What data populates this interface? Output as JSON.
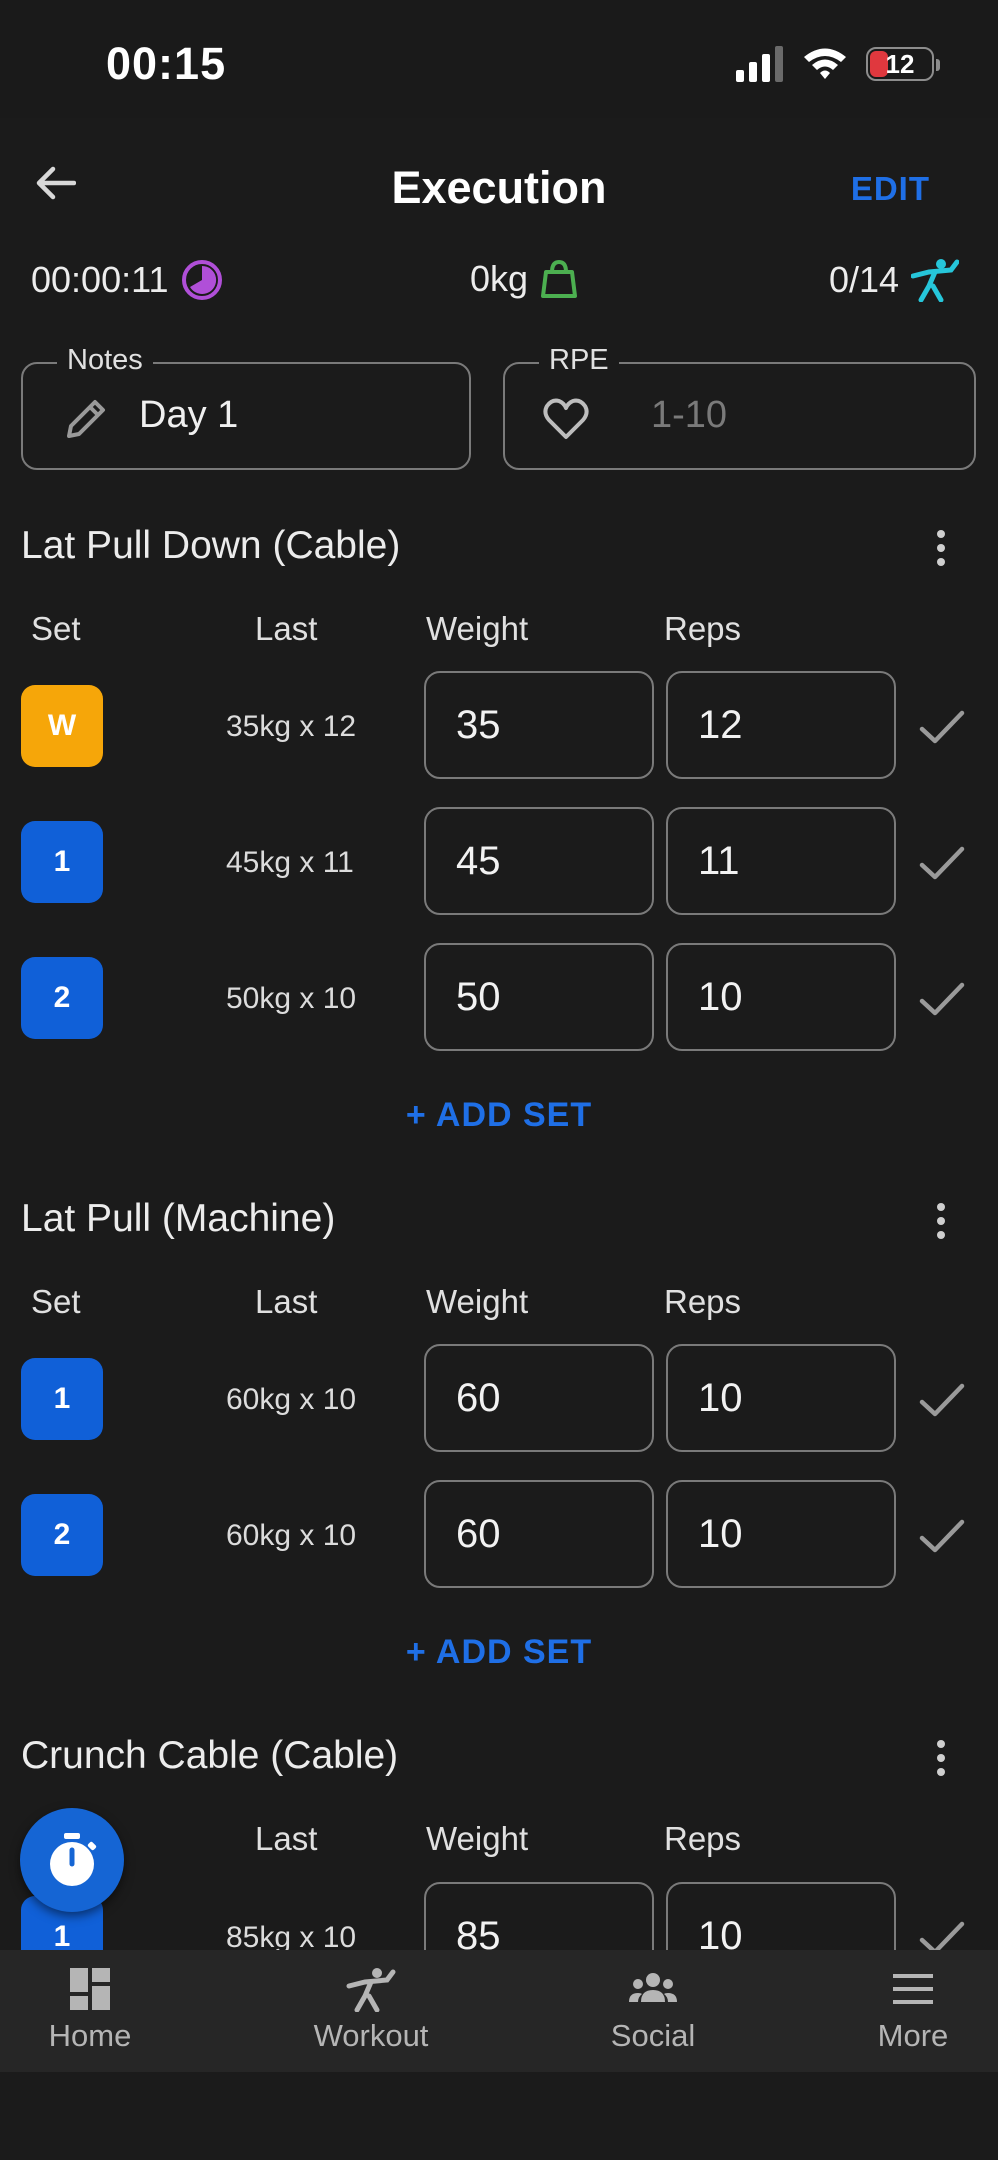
{
  "status_bar": {
    "time": "00:15",
    "battery": "12"
  },
  "header": {
    "title": "Execution",
    "edit_label": "EDIT"
  },
  "stats": {
    "duration": "00:00:11",
    "volume": "0kg",
    "sets_done": "0/14"
  },
  "notes": {
    "label": "Notes",
    "value": "Day 1"
  },
  "rpe": {
    "label": "RPE",
    "placeholder": "1-10"
  },
  "columns": {
    "set": "Set",
    "last": "Last",
    "weight": "Weight",
    "reps": "Reps"
  },
  "add_set_label": "+ ADD SET",
  "exercises": [
    {
      "name": "Lat Pull Down (Cable)",
      "sets": [
        {
          "badge": "W",
          "type": "warmup",
          "last": "35kg x 12",
          "weight": "35",
          "reps": "12"
        },
        {
          "badge": "1",
          "type": "normal",
          "last": "45kg x 11",
          "weight": "45",
          "reps": "11"
        },
        {
          "badge": "2",
          "type": "normal",
          "last": "50kg x 10",
          "weight": "50",
          "reps": "10"
        }
      ]
    },
    {
      "name": "Lat Pull (Machine)",
      "sets": [
        {
          "badge": "1",
          "type": "normal",
          "last": "60kg x 10",
          "weight": "60",
          "reps": "10"
        },
        {
          "badge": "2",
          "type": "normal",
          "last": "60kg x 10",
          "weight": "60",
          "reps": "10"
        }
      ]
    },
    {
      "name": "Crunch Cable (Cable)",
      "sets": [
        {
          "badge": "1",
          "type": "normal",
          "last": "85kg x 10",
          "weight": "85",
          "reps": "10"
        }
      ]
    }
  ],
  "nav": [
    {
      "label": "Home",
      "icon": "dashboard-icon"
    },
    {
      "label": "Workout",
      "icon": "workout-icon"
    },
    {
      "label": "Social",
      "icon": "people-icon"
    },
    {
      "label": "More",
      "icon": "menu-icon"
    }
  ],
  "colors": {
    "background": "#1b1b1b",
    "accent_blue": "#1f6fe6",
    "warmup_orange": "#f6a609",
    "set_blue": "#1060d8",
    "timer_purple": "#b04fd8",
    "weight_green": "#4caf50",
    "sets_cyan": "#26c6da"
  }
}
